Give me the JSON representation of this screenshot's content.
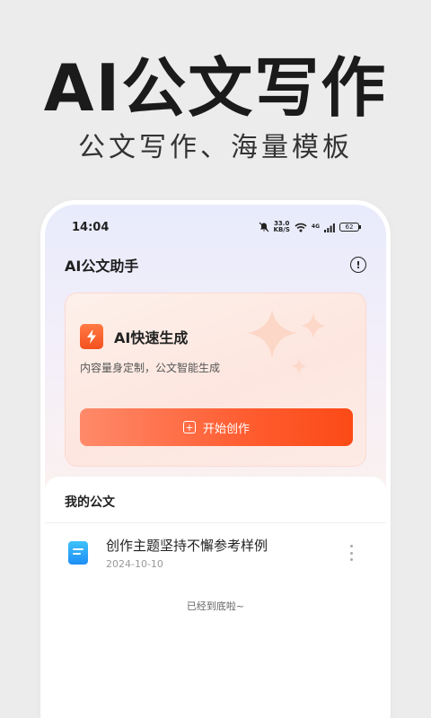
{
  "promo": {
    "headline": "AI公文写作",
    "subhead": "公文写作、海量模板"
  },
  "status_bar": {
    "time": "14:04",
    "net_speed_value": "33.0",
    "net_speed_unit": "KB/S",
    "network": "4G",
    "battery": "62"
  },
  "app": {
    "title": "AI公文助手",
    "info_icon": "info-icon"
  },
  "feature_card": {
    "title": "AI快速生成",
    "description": "内容量身定制，公文智能生成",
    "button_label": "开始创作",
    "icon": "lightning-icon",
    "accent_color": "#fb4a16"
  },
  "documents": {
    "section_title": "我的公文",
    "items": [
      {
        "title": "创作主题坚持不懈参考样例",
        "date": "2024-10-10",
        "icon": "document-icon"
      }
    ],
    "end_text": "已经到底啦~"
  }
}
